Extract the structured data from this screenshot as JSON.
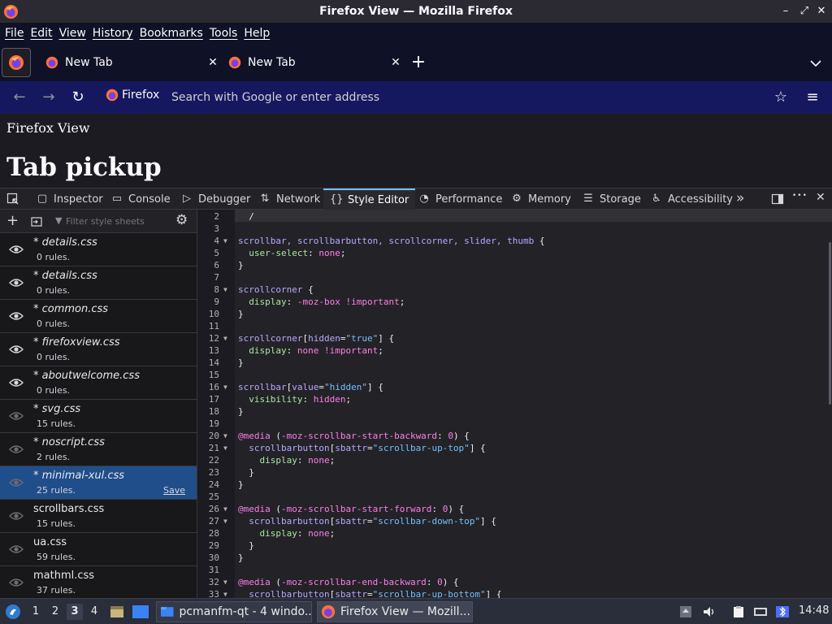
{
  "window": {
    "title": "Firefox View — Mozilla Firefox",
    "minimize": "–",
    "maximize": "⤢",
    "close": "✕"
  },
  "menubar": {
    "items": [
      "File",
      "Edit",
      "View",
      "History",
      "Bookmarks",
      "Tools",
      "Help"
    ]
  },
  "tabs": [
    {
      "label": "New Tab",
      "close": "✕"
    },
    {
      "label": "New Tab",
      "close": "✕"
    }
  ],
  "newtab_label": "+",
  "navbar": {
    "back": "←",
    "forward": "→",
    "reload": "↻",
    "identity_label": "Firefox",
    "url_placeholder": "Search with Google or enter address",
    "bookmark": "☆",
    "menu": "≡"
  },
  "page": {
    "breadcrumb": "Firefox View",
    "heading": "Tab pickup"
  },
  "devtools": {
    "tabs": [
      {
        "label": "Inspector",
        "icon": "inspector-icon"
      },
      {
        "label": "Console",
        "icon": "console-icon"
      },
      {
        "label": "Debugger",
        "icon": "debugger-icon"
      },
      {
        "label": "Network",
        "icon": "network-icon"
      },
      {
        "label": "Style Editor",
        "icon": "style-editor-icon"
      },
      {
        "label": "Performance",
        "icon": "performance-icon"
      },
      {
        "label": "Memory",
        "icon": "memory-icon"
      },
      {
        "label": "Storage",
        "icon": "storage-icon"
      },
      {
        "label": "Accessibility",
        "icon": "accessibility-icon"
      }
    ],
    "selected_tab": "Style Editor",
    "more": "»",
    "dots": "•••",
    "close": "✕"
  },
  "sidebar": {
    "filter_placeholder": "Filter style sheets",
    "save_label": "Save",
    "sheets": [
      {
        "name": "* details.css",
        "rules": "0 rules.",
        "visible": true,
        "unsaved": true
      },
      {
        "name": "* details.css",
        "rules": "0 rules.",
        "visible": true,
        "unsaved": true
      },
      {
        "name": "* common.css",
        "rules": "0 rules.",
        "visible": true,
        "unsaved": true
      },
      {
        "name": "* firefoxview.css",
        "rules": "0 rules.",
        "visible": true,
        "unsaved": true
      },
      {
        "name": "* aboutwelcome.css",
        "rules": "0 rules.",
        "visible": true,
        "unsaved": true
      },
      {
        "name": "* svg.css",
        "rules": "15 rules.",
        "visible": false,
        "unsaved": true
      },
      {
        "name": "* noscript.css",
        "rules": "2 rules.",
        "visible": false,
        "unsaved": true
      },
      {
        "name": "* minimal-xul.css",
        "rules": "25 rules.",
        "visible": false,
        "unsaved": true,
        "selected": true
      },
      {
        "name": "scrollbars.css",
        "rules": "15 rules.",
        "visible": false,
        "unsaved": false
      },
      {
        "name": "ua.css",
        "rules": "59 rules.",
        "visible": false,
        "unsaved": false
      },
      {
        "name": "mathml.css",
        "rules": "37 rules.",
        "visible": false,
        "unsaved": false
      }
    ]
  },
  "editor": {
    "lines": [
      {
        "n": "2",
        "fold": false,
        "text": "  /"
      },
      {
        "n": "3",
        "fold": false,
        "text": ""
      },
      {
        "n": "4",
        "fold": true,
        "text": "scrollbar, scrollbarbutton, scrollcorner, slider, thumb {"
      },
      {
        "n": "5",
        "fold": false,
        "text": "  user-select: none;"
      },
      {
        "n": "6",
        "fold": false,
        "text": "}"
      },
      {
        "n": "7",
        "fold": false,
        "text": ""
      },
      {
        "n": "8",
        "fold": true,
        "text": "scrollcorner {"
      },
      {
        "n": "9",
        "fold": false,
        "text": "  display: -moz-box !important;"
      },
      {
        "n": "10",
        "fold": false,
        "text": "}"
      },
      {
        "n": "11",
        "fold": false,
        "text": ""
      },
      {
        "n": "12",
        "fold": true,
        "text": "scrollcorner[hidden=\"true\"] {"
      },
      {
        "n": "13",
        "fold": false,
        "text": "  display: none !important;"
      },
      {
        "n": "14",
        "fold": false,
        "text": "}"
      },
      {
        "n": "15",
        "fold": false,
        "text": ""
      },
      {
        "n": "16",
        "fold": true,
        "text": "scrollbar[value=\"hidden\"] {"
      },
      {
        "n": "17",
        "fold": false,
        "text": "  visibility: hidden;"
      },
      {
        "n": "18",
        "fold": false,
        "text": "}"
      },
      {
        "n": "19",
        "fold": false,
        "text": ""
      },
      {
        "n": "20",
        "fold": true,
        "text": "@media (-moz-scrollbar-start-backward: 0) {"
      },
      {
        "n": "21",
        "fold": true,
        "text": "  scrollbarbutton[sbattr=\"scrollbar-up-top\"] {"
      },
      {
        "n": "22",
        "fold": false,
        "text": "    display: none;"
      },
      {
        "n": "23",
        "fold": false,
        "text": "  }"
      },
      {
        "n": "24",
        "fold": false,
        "text": "}"
      },
      {
        "n": "25",
        "fold": false,
        "text": ""
      },
      {
        "n": "26",
        "fold": true,
        "text": "@media (-moz-scrollbar-start-forward: 0) {"
      },
      {
        "n": "27",
        "fold": true,
        "text": "  scrollbarbutton[sbattr=\"scrollbar-down-top\"] {"
      },
      {
        "n": "28",
        "fold": false,
        "text": "    display: none;"
      },
      {
        "n": "29",
        "fold": false,
        "text": "  }"
      },
      {
        "n": "30",
        "fold": false,
        "text": "}"
      },
      {
        "n": "31",
        "fold": false,
        "text": ""
      },
      {
        "n": "32",
        "fold": true,
        "text": "@media (-moz-scrollbar-end-backward: 0) {"
      },
      {
        "n": "33",
        "fold": true,
        "text": "  scrollbarbutton[sbattr=\"scrollbar-up-bottom\"] {"
      }
    ]
  },
  "taskbar": {
    "workspaces": [
      "1",
      "2",
      "3",
      "4"
    ],
    "selected_workspace": "3",
    "tasks": [
      {
        "label": "pcmanfm-qt - 4 windo...",
        "icon": "folder-icon"
      },
      {
        "label": "Firefox View — Mozill...",
        "icon": "firefox-icon"
      }
    ],
    "clock": "14:48"
  },
  "colors": {
    "accent": "#75bfff",
    "selection": "#204e8a",
    "menubar_bg": "#0f1126",
    "navbar_bg": "#16185f"
  }
}
